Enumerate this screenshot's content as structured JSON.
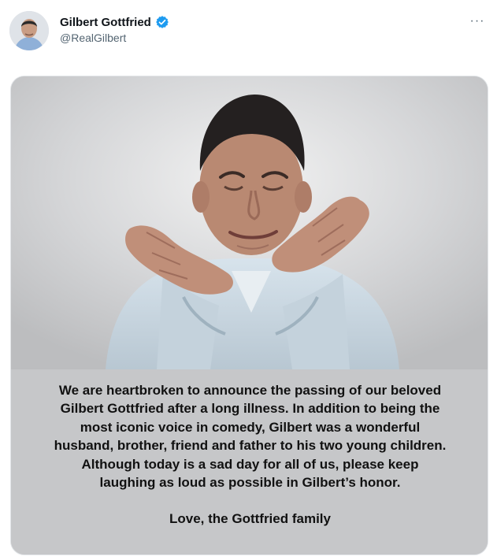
{
  "tweet": {
    "author": {
      "display_name": "Gilbert Gottfried",
      "handle": "@RealGilbert",
      "verified_icon": "verified-badge-icon",
      "verified_color": "#1d9bf0"
    },
    "more_label": "···",
    "media": {
      "photo_subject": "portrait-photo",
      "caption_lines": [
        "We are heartbroken to announce the passing of our beloved",
        "Gilbert Gottfried after a long illness.  In addition to being the",
        "most iconic voice in comedy, Gilbert was a wonderful",
        "husband, brother, friend and father to his two young children.",
        "Although today is a sad day for all of us, please keep",
        "laughing as loud as possible in Gilbert’s honor."
      ],
      "signoff": "Love, the Gottfried family"
    }
  },
  "colors": {
    "name_text": "#0f1419",
    "secondary_text": "#536471",
    "caption_background": "#c6c7c9",
    "photo_background": "#c7c8ca"
  }
}
